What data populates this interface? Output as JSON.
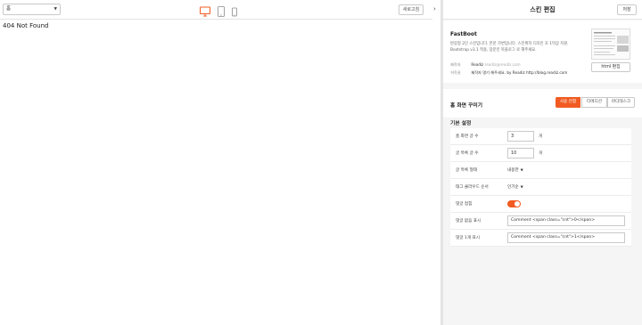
{
  "toolbar": {
    "page_select": "홈",
    "new_button": "새로고침"
  },
  "preview": {
    "message": "404 Not Found"
  },
  "panel": {
    "title": "스킨 편집",
    "save_button": "저장",
    "skin": {
      "name": "FastBoot",
      "description": "반응형 2단 스킨입니다. 본문 가변입니다. 스킨위치 디자인 초 1억상 지원. Bootstrap v3.1 적용, 장문인 북을로그 로 해주세요.",
      "author_label": "제작자",
      "author_name": "Readiz",
      "author_email": "readiz@readiz.com",
      "copyright_label": "저작권",
      "copyright_text": "제작자 명기 해주세요. by Readiz http://blog.readiz.com",
      "html_edit_button": "html 편집"
    },
    "home_section": {
      "title": "홈 화면 꾸미기",
      "tabs": [
        "사용 안함",
        "티에디션",
        "마디테스크"
      ]
    },
    "basic": {
      "title": "기본 설정",
      "rows": [
        {
          "label": "홈 화면 글 수",
          "value": "3",
          "unit": "개"
        },
        {
          "label": "글 목록 글 수",
          "value": "10",
          "unit": "개"
        },
        {
          "label": "글 목록 형태",
          "value": "내용만"
        },
        {
          "label": "태그 클라우드 순서",
          "value": "인기순"
        },
        {
          "label": "댓글 접힘",
          "value": "on"
        },
        {
          "label": "댓글 없음 표시",
          "value": "Comment <span class=\"cnt\">0</span>"
        },
        {
          "label": "댓글 1개 표시",
          "value": "Comment <span class=\"cnt\">1</span>"
        }
      ]
    }
  },
  "colors": {
    "accent": "#f15b22",
    "divider": "#e4e4e4",
    "panel_bg": "#f5f5f5"
  }
}
